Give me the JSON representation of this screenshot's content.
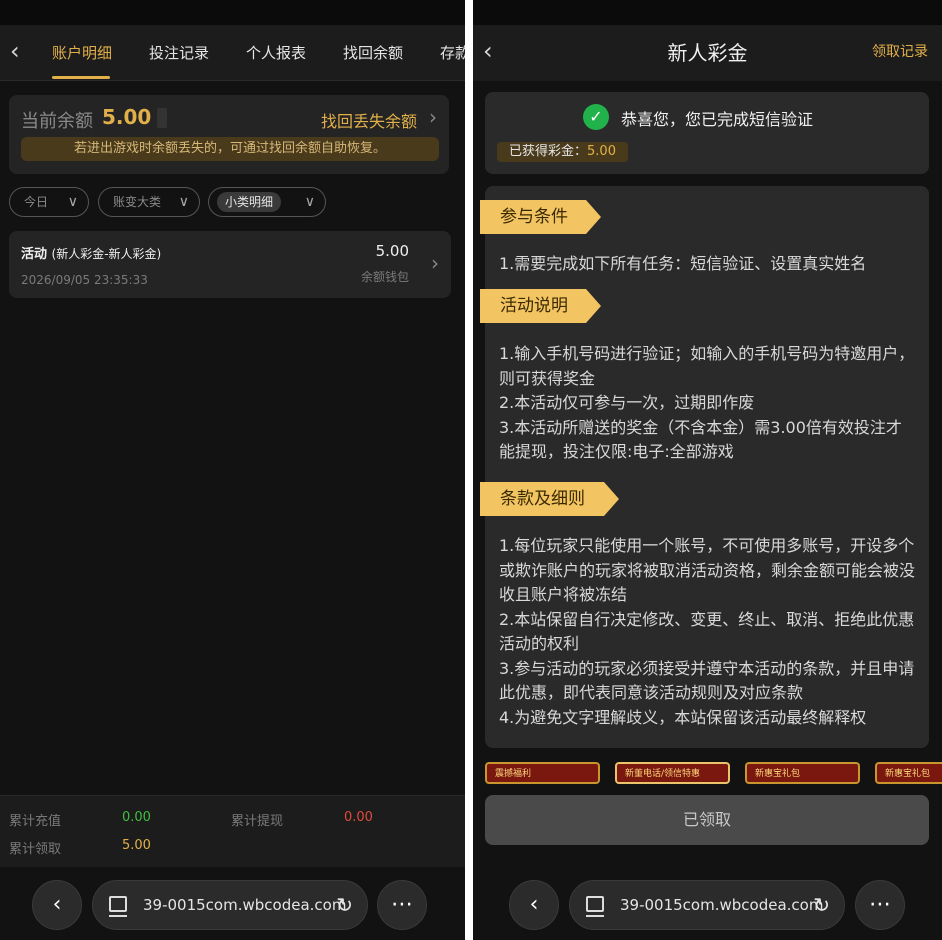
{
  "left": {
    "tabs": [
      {
        "label": "账户明细"
      },
      {
        "label": "投注记录"
      },
      {
        "label": "个人报表"
      },
      {
        "label": "找回余额"
      },
      {
        "label": "存款"
      }
    ],
    "balance": {
      "label": "当前余额",
      "value": "5.00",
      "recover_link": "找回丢失余额",
      "notice": "若进出游戏时余额丢失的，可通过找回余额自助恢复。"
    },
    "filters": [
      {
        "label": "今日"
      },
      {
        "label": "账变大类"
      },
      {
        "label": "小类明细"
      }
    ],
    "record": {
      "title": "活动",
      "subtitle": "(新人彩金-新人彩金)",
      "time": "2026/09/05 23:35:33",
      "amount": "5.00",
      "wallet": "余额钱包"
    },
    "summary": {
      "deposit_label": "累计充值",
      "deposit_value": "0.00",
      "withdraw_label": "累计提现",
      "withdraw_value": "0.00",
      "claim_label": "累计领取",
      "claim_value": "5.00"
    },
    "browser": {
      "url": "39-0015com.wbcodea.com"
    }
  },
  "right": {
    "header": {
      "title": "新人彩金",
      "link": "领取记录"
    },
    "verify": {
      "message": "恭喜您，您已完成短信验证",
      "reward_label": "已获得彩金：",
      "reward_value": "5.00"
    },
    "sections": [
      {
        "title": "参与条件",
        "text": "1.需要完成如下所有任务：短信验证、设置真实姓名"
      },
      {
        "title": "活动说明",
        "text": "1.输入手机号码进行验证；如输入的手机号码为特邀用户，则可获得奖金\n2.本活动仅可参与一次，过期即作废\n3.本活动所赠送的奖金（不含本金）需3.00倍有效投注才能提现，投注仅限:电子:全部游戏"
      },
      {
        "title": "条款及细则",
        "text": "1.每位玩家只能使用一个账号，不可使用多账号，开设多个或欺诈账户的玩家将被取消活动资格，剩余金额可能会被没收且账户将被冻结\n2.本站保留自行决定修改、变更、终止、取消、拒绝此优惠活动的权利\n3.参与活动的玩家必须接受并遵守本活动的条款，并且申请此优惠，即代表同意该活动规则及对应条款\n4.为避免文字理解歧义，本站保留该活动最终解释权"
      }
    ],
    "banners": [
      {
        "label": "震撼福利"
      },
      {
        "label": "新董电话/领信特惠"
      },
      {
        "label": "新惠宝礼包"
      },
      {
        "label": "新惠宝礼包"
      }
    ],
    "claim_button": "已领取",
    "browser": {
      "url": "39-0015com.wbcodea.com"
    }
  },
  "colors": {
    "accent": "#e2b04a",
    "success": "#21b24b",
    "danger": "#e14b3b",
    "green_value": "#3fbf3f"
  }
}
